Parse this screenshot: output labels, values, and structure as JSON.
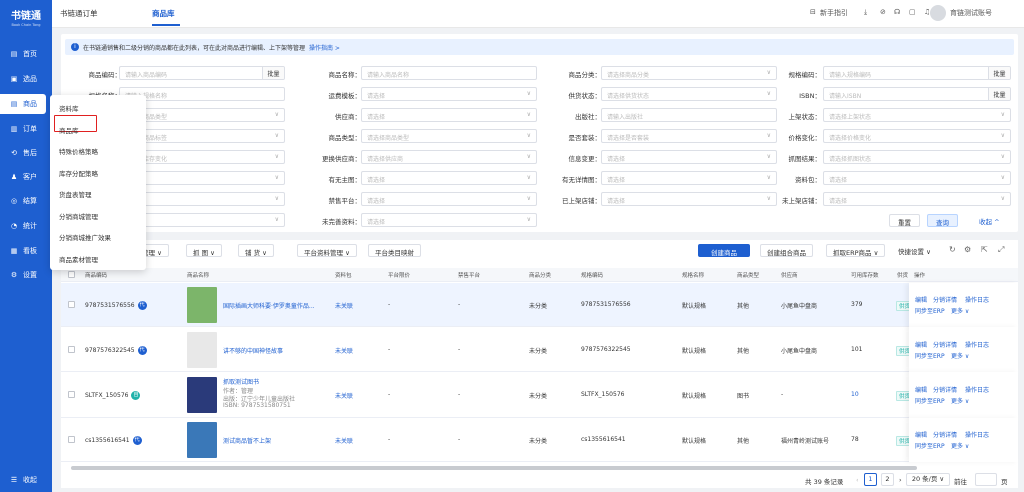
{
  "brand": {
    "name": "书链通",
    "sub": "Book Chain Tong"
  },
  "sidebar": {
    "items": [
      {
        "icon": "▤",
        "label": "首页"
      },
      {
        "icon": "▣",
        "label": "选品"
      },
      {
        "icon": "▤",
        "label": "商品"
      },
      {
        "icon": "▥",
        "label": "订单"
      },
      {
        "icon": "⟲",
        "label": "售后"
      },
      {
        "icon": "♟",
        "label": "客户"
      },
      {
        "icon": "◎",
        "label": "结算"
      },
      {
        "icon": "◔",
        "label": "统计"
      },
      {
        "icon": "▦",
        "label": "看板"
      },
      {
        "icon": "⚙",
        "label": "设置"
      }
    ],
    "collapse": "收起"
  },
  "topbar": {
    "tabs": [
      "书链通订单",
      "商品库"
    ],
    "guide": "新手指引",
    "account": "育链测试账号"
  },
  "tip": {
    "text": "在书链通销售和二级分销的商品都在此列表，可在此对商品进行编辑、上下架等管理",
    "link": "操作指南 >"
  },
  "filters": {
    "rows": [
      [
        {
          "label": "商品编码：",
          "ph": "请输入商品编码",
          "btn": "批量"
        },
        {
          "label": "商品名称：",
          "ph": "请输入商品名称"
        },
        {
          "label": "商品分类：",
          "ph": "请选择商品分类",
          "arrow": true
        },
        {
          "label": "规格编码：",
          "ph": "请输入规格编码",
          "btn": "批量"
        }
      ],
      [
        {
          "label": "规格名称：",
          "ph": "请输入规格名称"
        },
        {
          "label": "运费模板：",
          "ph": "请选择",
          "arrow": true
        },
        {
          "label": "供货状态：",
          "ph": "请选择供货状态",
          "arrow": true
        },
        {
          "label": "ISBN：",
          "ph": "请输入ISBN",
          "btn": "批量"
        }
      ],
      [
        {
          "label": "",
          "ph": "请选择商品类型",
          "arrow": true
        },
        {
          "label": "供应商：",
          "ph": "请选择",
          "arrow": true
        },
        {
          "label": "出版社：",
          "ph": "请输入出版社"
        },
        {
          "label": "上架状态：",
          "ph": "请选择上架状态",
          "arrow": true
        }
      ],
      [
        {
          "label": "",
          "ph": "请选择商品标签",
          "arrow": true
        },
        {
          "label": "商品类型：",
          "ph": "请选择商品类型",
          "arrow": true
        },
        {
          "label": "是否套装：",
          "ph": "请选择是否套装",
          "arrow": true
        },
        {
          "label": "价格变化：",
          "ph": "请选择价格变化",
          "arrow": true
        }
      ],
      [
        {
          "label": "",
          "ph": "请选择库存变化",
          "arrow": true
        },
        {
          "label": "更换供应商：",
          "ph": "请选择供应商",
          "arrow": true
        },
        {
          "label": "信息变更：",
          "ph": "请选择",
          "arrow": true
        },
        {
          "label": "抓图结果：",
          "ph": "请选择抓图状态",
          "arrow": true
        }
      ],
      [
        {
          "label": "",
          "ph": "请选择",
          "arrow": true
        },
        {
          "label": "有无主图：",
          "ph": "请选择",
          "arrow": true
        },
        {
          "label": "有无详情图：",
          "ph": "请选择",
          "arrow": true
        },
        {
          "label": "资料包：",
          "ph": "请选择",
          "arrow": true
        }
      ],
      [
        {
          "label": "",
          "ph": "请选择",
          "arrow": true
        },
        {
          "label": "禁售平台：",
          "ph": "请选择",
          "arrow": true
        },
        {
          "label": "已上架店铺：",
          "ph": "请选择",
          "arrow": true
        },
        {
          "label": "未上架店铺：",
          "ph": "请选择",
          "arrow": true
        }
      ],
      [
        {
          "label": "",
          "ph": "请选择",
          "arrow": true
        },
        {
          "label": "未完善资料：",
          "ph": "请选择",
          "arrow": true
        }
      ]
    ],
    "reset": "重置",
    "query": "查询",
    "collapse": "收起 ^"
  },
  "submenu": [
    "资料库",
    "商品库",
    "特殊价格策略",
    "库存分配策略",
    "货盘表管理",
    "分销商城管理",
    "分销商城推广效果",
    "商品素材管理"
  ],
  "toolbar": {
    "buttons": [
      "管理 ∨",
      "抓 图 ∨",
      "铺 货 ∨",
      "平台资料管理 ∨",
      "平台类目映射"
    ],
    "create": "创建商品",
    "create_combo": "创建组合商品",
    "fetch_erp": "抓取ERP商品 ∨",
    "quick": "快捷设置 ∨"
  },
  "table": {
    "headers": [
      "商品编码",
      "商品名称",
      "资料包",
      "平台限价",
      "禁售平台",
      "商品分类",
      "规格编码",
      "规格名称",
      "商品类型",
      "供应商",
      "可用库存数",
      "供货",
      "操作"
    ],
    "rows": [
      {
        "code": "9787531576556",
        "badge": "代",
        "name": "国际插画大师科要·伊罗奥童作品...",
        "pkg": "未关联",
        "limit": "-",
        "banned": "-",
        "cat": "未分类",
        "sku": "9787531576556",
        "spec": "默认规格",
        "type": "其他",
        "supplier": "小尾鱼中盘商",
        "stock": "379",
        "ops": [
          "编辑",
          "分销详情",
          "操作日志",
          "同步至ERP",
          "更多 ∨"
        ]
      },
      {
        "code": "9787576322545",
        "badge": "代",
        "name": "讲不够的中国神怪故事",
        "pkg": "未关联",
        "limit": "-",
        "banned": "-",
        "cat": "未分类",
        "sku": "9787576322545",
        "spec": "默认规格",
        "type": "其他",
        "supplier": "小尾鱼中盘商",
        "stock": "101",
        "ops": [
          "编辑",
          "分销详情",
          "操作日志",
          "同步至ERP",
          "更多 ∨"
        ]
      },
      {
        "code": "SLTFX_150576",
        "badge": "自",
        "name": "抓取测试图书",
        "sub": [
          "作者：管理",
          "出版：辽宁少年儿童出版社",
          "ISBN: 9787531580751"
        ],
        "pkg": "未关联",
        "limit": "-",
        "banned": "-",
        "cat": "未分类",
        "sku": "SLTFX_150576",
        "spec": "默认规格",
        "type": "图书",
        "supplier": "-",
        "stock": "10",
        "ops": [
          "编辑",
          "分销详情",
          "操作日志",
          "同步至ERP",
          "更多 ∨"
        ]
      },
      {
        "code": "cs1355616541",
        "badge": "代",
        "name": "测试商品暂不上架",
        "pkg": "未关联",
        "limit": "-",
        "banned": "-",
        "cat": "未分类",
        "sku": "cs1355616541",
        "spec": "默认规格",
        "type": "其他",
        "supplier": "福州青岭测试账号",
        "stock": "78",
        "ops": [
          "编辑",
          "分销详情",
          "操作日志",
          "同步至ERP",
          "更多 ∨"
        ]
      }
    ],
    "supply_tag": "供货"
  },
  "pager": {
    "total": "共 39 条记录",
    "pages": [
      "1",
      "2"
    ],
    "size": "20 条/页 ∨",
    "goto": "前往",
    "page_unit": "页"
  },
  "colors": {
    "primary": "#1e5fd0",
    "highlight": "#e02020"
  }
}
